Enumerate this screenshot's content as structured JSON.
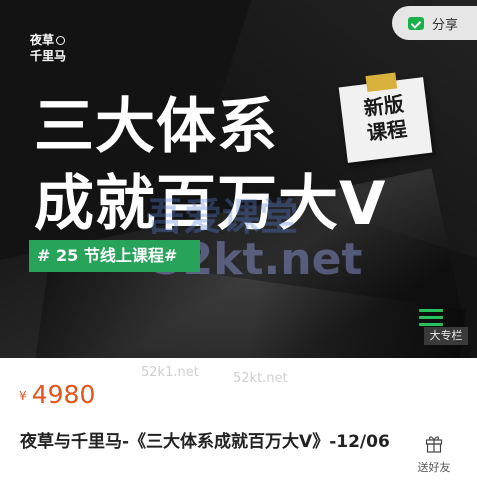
{
  "banner": {
    "brand_line1": "夜草",
    "brand_line2": "千里马",
    "title_line1": "三大体系",
    "title_line2": "成就百万大V",
    "sticky_note_line1": "新版",
    "sticky_note_line2": "课程",
    "tag_text": "# 25 节线上课程#",
    "watermark_line1": "吾爱课堂",
    "watermark_line2": "52kt.net",
    "column_label": "大专栏",
    "colors": {
      "background": "#131313",
      "tag_green": "#27a35a",
      "note_tape": "#d8b03c"
    }
  },
  "share_button": {
    "label": "分享",
    "icon": "wechat-share-icon"
  },
  "page_watermarks": [
    "52k1.net",
    "52kt.net"
  ],
  "price": {
    "symbol": "¥",
    "value": "4980",
    "color": "#e5521b"
  },
  "course": {
    "title": "夜草与千里马-《三大体系成就百万大V》-12/06"
  },
  "gift": {
    "label": "送好友",
    "icon": "gift-icon"
  }
}
